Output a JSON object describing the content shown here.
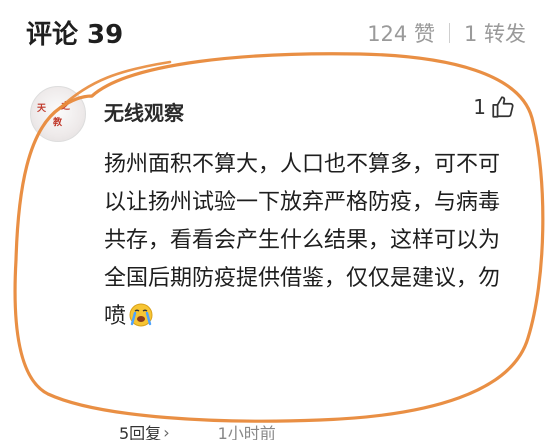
{
  "header": {
    "comments_title": "评论 39",
    "likes": "124 赞",
    "reposts": "1 转发"
  },
  "comment": {
    "avatar_text": [
      "之",
      "教",
      "天"
    ],
    "username": "无线观察",
    "like_count": "1",
    "body": "扬州面积不算大，人口也不算多，可不可以让扬州试验一下放弃严格防疫，与病毒共存，看看会产生什么结果，这样可以为全国后期防疫提供借鉴，仅仅是建议，勿喷",
    "replies": "5回复",
    "time": "1小时前"
  },
  "colors": {
    "annotation": "#e8893a",
    "muted": "#9a9a9a"
  },
  "icons": [
    "thumbs-up-icon",
    "crying-emoji-icon",
    "chevron-right-icon"
  ]
}
